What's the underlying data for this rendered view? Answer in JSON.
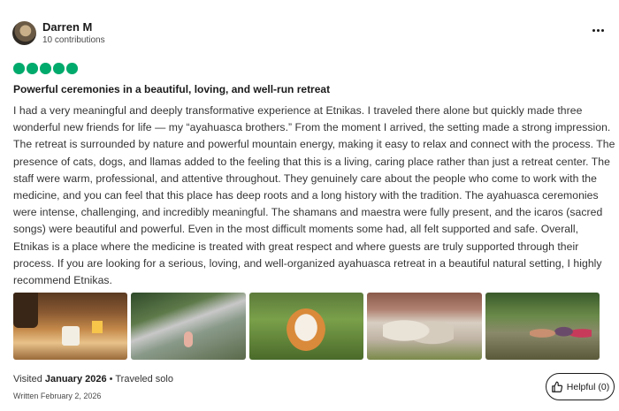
{
  "reviewer": {
    "name": "Darren M",
    "contributions": "10 contributions"
  },
  "more_icon": "more-horizontal-icon",
  "rating": {
    "value": 5,
    "max": 5,
    "color": "#00aa6c"
  },
  "review": {
    "title": "Powerful ceremonies in a beautiful, loving, and well-run retreat",
    "body": "I had a very meaningful and deeply transformative experience at Etnikas. I traveled there alone but quickly made three wonderful new friends for life — my “ayahuasca brothers.” From the moment I arrived, the setting made a strong impression. The retreat is surrounded by nature and powerful mountain energy, making it easy to relax and connect with the process. The presence of cats, dogs, and llamas added to the feeling that this is a living, caring place rather than just a retreat center. The staff were warm, professional, and attentive throughout. They genuinely care about the people who come to work with the medicine, and you can feel that this place has deep roots and a long history with the tradition. The ayahuasca ceremonies were intense, challenging, and incredibly meaningful. The shamans and maestra were fully present, and the icaros (sacred songs) were beautiful and powerful. Even in the most difficult moments some had, all felt supported and safe. Overall, Etnikas is a place where the medicine is treated with great respect and where guests are truly supported through their process. If you are looking for a serious, loving, and well-organized ayahuasca retreat in a beautiful natural setting, I highly recommend Etnikas."
  },
  "visit": {
    "prefix": "Visited ",
    "date": "January 2026",
    "separator": " • ",
    "trip_type": "Traveled solo"
  },
  "written": "Written February 2, 2026",
  "helpful": {
    "label": "Helpful (0)",
    "icon": "thumbs-up-icon"
  }
}
